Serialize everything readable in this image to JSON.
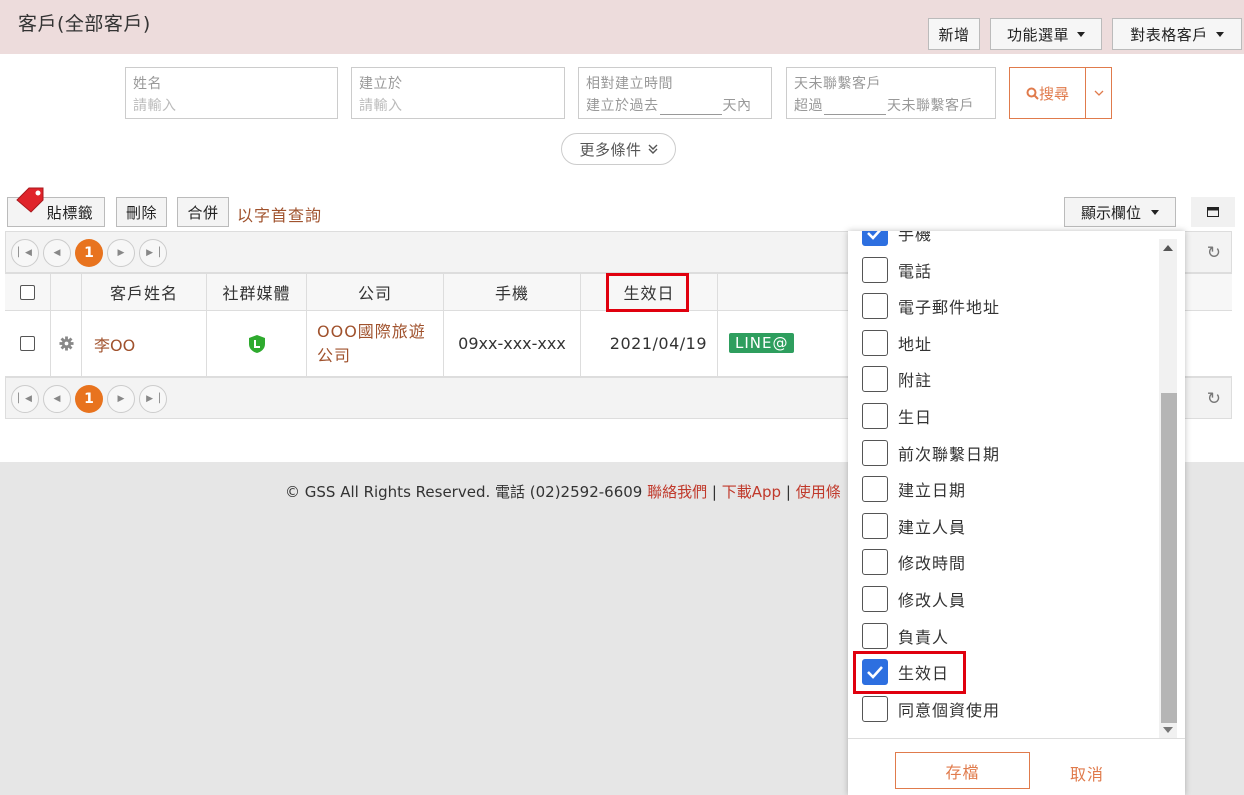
{
  "header": {
    "title": "客戶(全部客戶)",
    "buttons": {
      "add": "新增",
      "functions": "功能選單",
      "table_customers": "對表格客戶"
    }
  },
  "search": {
    "name": {
      "label": "姓名",
      "placeholder": "請輸入"
    },
    "created_at": {
      "label": "建立於",
      "placeholder": "請輸入"
    },
    "relative_created": {
      "label": "相對建立時間",
      "prefix": "建立於過去",
      "suffix": "天內"
    },
    "no_contact": {
      "label": "天未聯繫客戶",
      "prefix": "超過",
      "suffix": "天未聯繫客戶"
    },
    "search_button": "搜尋",
    "more_conditions": "更多條件"
  },
  "toolbar": {
    "tag": "貼標籤",
    "delete": "刪除",
    "merge": "合併",
    "alpha_query": "以字首查詢",
    "show_columns": "顯示欄位"
  },
  "pagination": {
    "current_page": "1"
  },
  "table": {
    "columns": [
      "客戶姓名",
      "社群媒體",
      "公司",
      "手機",
      "生效日"
    ],
    "rows": [
      {
        "name": "李OO",
        "company_line1": "OOO國際旅遊",
        "company_line2": "公司",
        "mobile": "09xx-xxx-xxx",
        "effective_date": "2021/04/19",
        "badge": "LINE@"
      }
    ]
  },
  "footer": {
    "copyright": "© GSS All Rights Reserved. 電話 (02)2592-6609",
    "contact": "聯絡我們",
    "sep": "|",
    "download": "下載App",
    "terms": "使用條"
  },
  "columns_panel": {
    "options": [
      {
        "label": "手機",
        "checked": true
      },
      {
        "label": "電話",
        "checked": false
      },
      {
        "label": "電子郵件地址",
        "checked": false
      },
      {
        "label": "地址",
        "checked": false
      },
      {
        "label": "附註",
        "checked": false
      },
      {
        "label": "生日",
        "checked": false
      },
      {
        "label": "前次聯繫日期",
        "checked": false
      },
      {
        "label": "建立日期",
        "checked": false
      },
      {
        "label": "建立人員",
        "checked": false
      },
      {
        "label": "修改時間",
        "checked": false
      },
      {
        "label": "修改人員",
        "checked": false
      },
      {
        "label": "負責人",
        "checked": false
      },
      {
        "label": "生效日",
        "checked": true
      },
      {
        "label": "同意個資使用",
        "checked": false
      }
    ],
    "save": "存檔",
    "cancel": "取消"
  },
  "colors": {
    "accent": "#e07b4c",
    "highlight": "#e0000e",
    "checkbox_checked": "#2d6fe0",
    "line_badge": "#2e9e5e"
  }
}
